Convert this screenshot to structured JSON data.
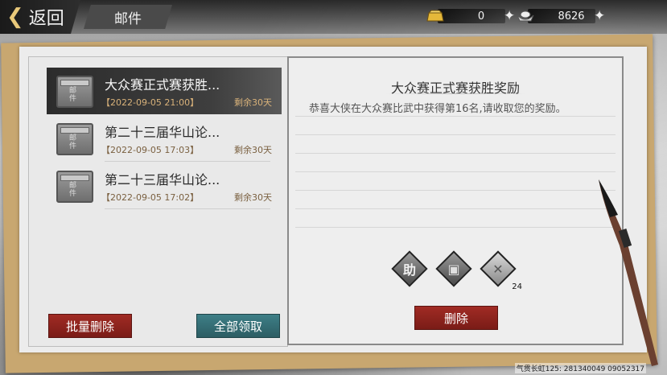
{
  "topbar": {
    "back_label": "返回",
    "tab_label": "邮件",
    "currencies": [
      {
        "name": "gold-ingot",
        "value": "0",
        "color": "#e5b83a"
      },
      {
        "name": "silver-ingot",
        "value": "8626",
        "color": "#d0d0d0"
      }
    ]
  },
  "mails": [
    {
      "title": "大众赛正式赛获胜...",
      "date": "【2022-09-05 21:00】",
      "remain": "剩余30天",
      "selected": true
    },
    {
      "title": "第二十三届华山论...",
      "date": "【2022-09-05 17:03】",
      "remain": "剩余30天",
      "selected": false
    },
    {
      "title": "第二十三届华山论...",
      "date": "【2022-09-05 17:02】",
      "remain": "剩余30天",
      "selected": false
    }
  ],
  "actions": {
    "batch_delete": "批量删除",
    "claim_all": "全部领取"
  },
  "detail": {
    "title": "大众赛正式赛获胜奖励",
    "body": "恭喜大侠在大众赛比武中获得第16名,请收取您的奖励。",
    "delete_label": "删除",
    "rewards": [
      {
        "icon": "assist-token-icon",
        "glyph": "助",
        "count": ""
      },
      {
        "icon": "treasure-chest-icon",
        "glyph": "▣",
        "count": ""
      },
      {
        "icon": "cross-token-icon",
        "glyph": "✕",
        "count": "24"
      }
    ]
  },
  "watermark": "气贯长虹125: 281340049  09052317",
  "colors": {
    "accent_red": "#8e231d",
    "accent_teal": "#356e75",
    "date_brown": "#7a6040"
  }
}
